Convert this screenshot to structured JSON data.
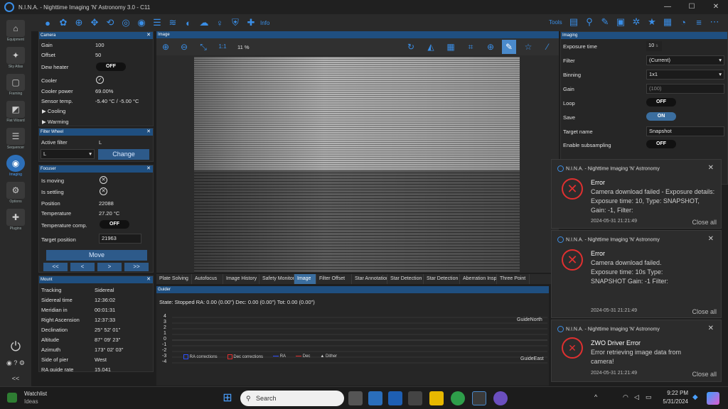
{
  "app": {
    "title": "N.I.N.A. - Nighttime Imaging 'N' Astronomy 3.0 - C11",
    "info": "Info",
    "tools": "Tools"
  },
  "nav": [
    {
      "label": "Equipment",
      "icon": "camera-icon"
    },
    {
      "label": "Sky Atlas",
      "icon": "sky-atlas-icon"
    },
    {
      "label": "Framing",
      "icon": "framing-icon"
    },
    {
      "label": "Flat Wizard",
      "icon": "flat-wizard-icon"
    },
    {
      "label": "Sequencer",
      "icon": "sequencer-icon"
    },
    {
      "label": "Imaging",
      "icon": "imaging-icon"
    },
    {
      "label": "Options",
      "icon": "options-icon"
    },
    {
      "label": "Plugins",
      "icon": "plugins-icon"
    }
  ],
  "camera": {
    "title": "Camera",
    "gain_l": "Gain",
    "gain_v": "100",
    "offset_l": "Offset",
    "offset_v": "50",
    "dew_l": "Dew heater",
    "dew_v": "OFF",
    "cooler_l": "Cooler",
    "power_l": "Cooler power",
    "power_v": "69.00%",
    "temp_l": "Sensor temp.",
    "temp_v": "-5.40 °C / -5.00 °C",
    "cooling": "Cooling",
    "warming": "Warming"
  },
  "filterwheel": {
    "title": "Filter Wheel",
    "active_l": "Active filter",
    "active_v": "L",
    "select_v": "L",
    "change": "Change"
  },
  "focuser": {
    "title": "Focuser",
    "moving_l": "Is moving",
    "settling_l": "Is settling",
    "pos_l": "Position",
    "pos_v": "22088",
    "temp_l": "Temperature",
    "temp_v": "27.20 °C",
    "comp_l": "Temperature comp.",
    "comp_v": "OFF",
    "target_l": "Target position",
    "target_v": "21963",
    "move": "Move",
    "b1": "<<",
    "b2": "<",
    "b3": ">",
    "b4": ">>"
  },
  "mount": {
    "title": "Mount",
    "rows": [
      {
        "l": "Tracking",
        "v": "Sidereal"
      },
      {
        "l": "Sidereal time",
        "v": "12:36:02"
      },
      {
        "l": "Meridian in",
        "v": "00:01:31"
      },
      {
        "l": "Right Ascension",
        "v": "12:37:33"
      },
      {
        "l": "Declination",
        "v": "25° 52' 01\""
      },
      {
        "l": "Altitude",
        "v": "87° 09' 23\""
      },
      {
        "l": "Azimuth",
        "v": "173° 02' 03\""
      },
      {
        "l": "Side of pier",
        "v": "West"
      },
      {
        "l": "RA guide rate",
        "v": "15.041"
      }
    ]
  },
  "image": {
    "title": "Image",
    "zoom_label": "1:1",
    "zoom_pct": "11 %"
  },
  "tabs": [
    "Plate Solving",
    "Autofocus",
    "Image History",
    "Safety Monitor",
    "Image",
    "Filter Offset",
    "Star Annotation",
    "Star Detection",
    "Star Detection",
    "Aberration Inspector",
    "Three Point"
  ],
  "guider": {
    "title": "Guider",
    "state": "State: Stopped  RA: 0.00 (0.00\")  Dec: 0.00 (0.00\")  Tot: 0.00 (0.00\")",
    "yticks": [
      "4",
      "3",
      "2",
      "1",
      "0",
      "-1",
      "-2",
      "-3",
      "-4"
    ],
    "north": "GuideNorth",
    "east": "GuideEast",
    "legend": [
      "RA corrections",
      "Dec corrections",
      "RA",
      "Dec",
      "Dither"
    ]
  },
  "imaging": {
    "title": "Imaging",
    "exp_l": "Exposure time",
    "exp_v": "10",
    "exp_unit": "s",
    "filter_l": "Filter",
    "filter_v": "(Current)",
    "bin_l": "Binning",
    "bin_v": "1x1",
    "gain_l": "Gain",
    "gain_v": "(100)",
    "loop_l": "Loop",
    "loop_v": "OFF",
    "save_l": "Save",
    "save_v": "ON",
    "target_l": "Target name",
    "target_v": "Snapshot",
    "sub_l": "Enable subsampling",
    "sub_v": "OFF"
  },
  "notifications": [
    {
      "app": "N.I.N.A. - Nighttime Imaging 'N' Astronomy",
      "title": "Error",
      "body": "Camera download failed - Exposure details: Exposure time: 10, Type: SNAPSHOT, Gain: -1, Filter:",
      "time": "2024-05-31 21:21:49",
      "close": "Close all"
    },
    {
      "app": "N.I.N.A. - Nighttime Imaging 'N' Astronomy",
      "title": "Error",
      "body": "Camera download failed. Exposure time: 10s Type: SNAPSHOT Gain: -1 Filter:",
      "time": "2024-05-31 21:21:49",
      "close": "Close all"
    },
    {
      "app": "N.I.N.A. - Nighttime Imaging 'N' Astronomy",
      "title": "ZWO Driver Error",
      "body": "Error retrieving image data from camera!",
      "time": "2024-05-31 21:21:49",
      "close": "Close all"
    }
  ],
  "taskbar": {
    "watchlist": "Watchlist",
    "ideas": "Ideas",
    "search": "Search",
    "time": "9:22 PM",
    "date": "5/31/2024"
  }
}
